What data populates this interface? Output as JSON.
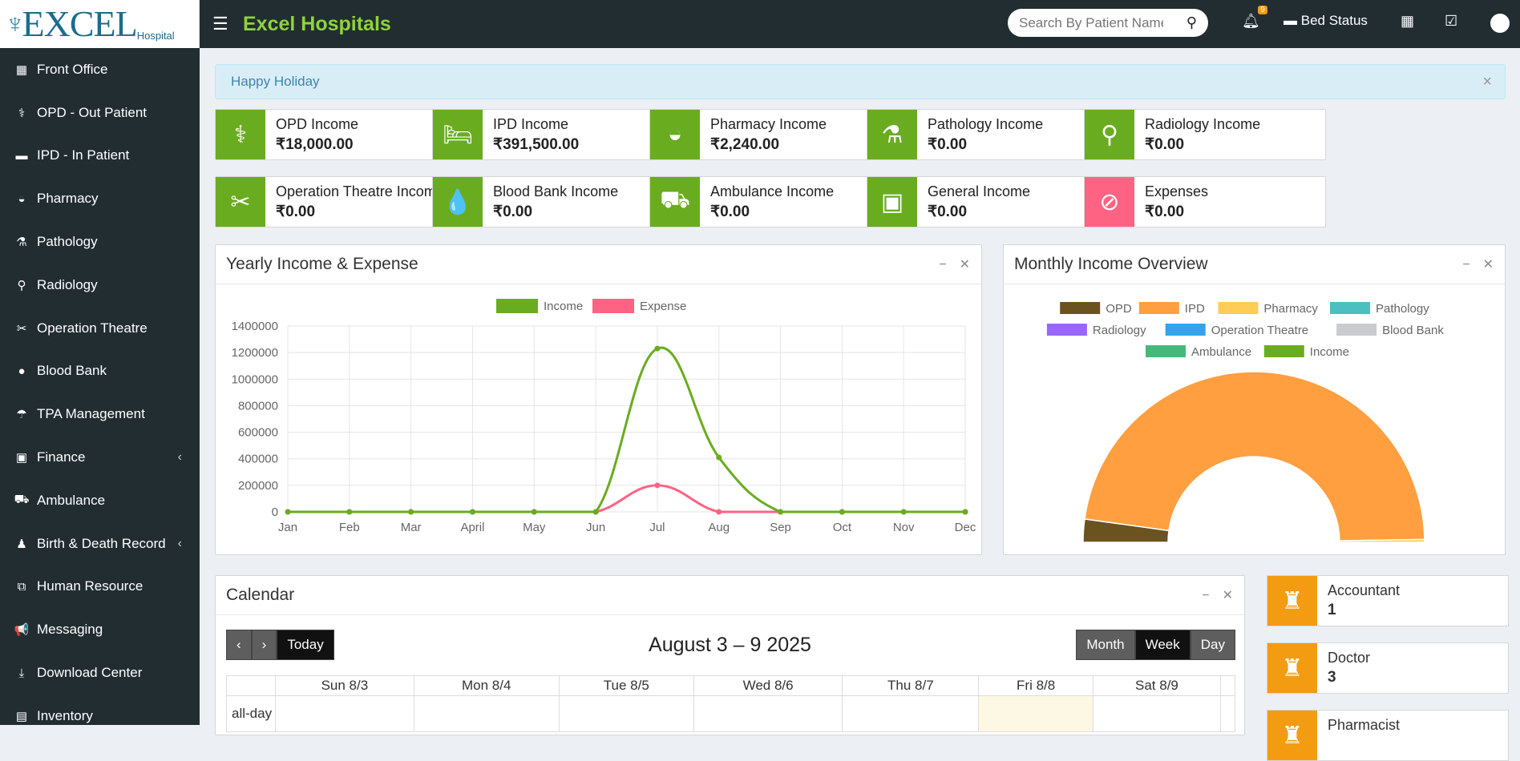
{
  "app": {
    "logo_text": "EXCEL",
    "logo_sub": "Hospital",
    "brand": "Excel Hospitals"
  },
  "sidebar": {
    "items": [
      {
        "label": "Front Office",
        "icon": "building-icon",
        "glyph": "▦"
      },
      {
        "label": "OPD - Out Patient",
        "icon": "stethoscope-icon",
        "glyph": "⚕"
      },
      {
        "label": "IPD - In Patient",
        "icon": "bed-icon",
        "glyph": "▬"
      },
      {
        "label": "Pharmacy",
        "icon": "mortar-icon",
        "glyph": "◒"
      },
      {
        "label": "Pathology",
        "icon": "flask-icon",
        "glyph": "⚗"
      },
      {
        "label": "Radiology",
        "icon": "microscope-icon",
        "glyph": "⚲"
      },
      {
        "label": "Operation Theatre",
        "icon": "scissors-icon",
        "glyph": "✂"
      },
      {
        "label": "Blood Bank",
        "icon": "drop-icon",
        "glyph": "●"
      },
      {
        "label": "TPA Management",
        "icon": "umbrella-icon",
        "glyph": "☂"
      },
      {
        "label": "Finance",
        "icon": "money-icon",
        "glyph": "▣",
        "caret": "‹"
      },
      {
        "label": "Ambulance",
        "icon": "ambulance-icon",
        "glyph": "⛟"
      },
      {
        "label": "Birth & Death Record",
        "icon": "family-icon",
        "glyph": "♟",
        "caret": "‹"
      },
      {
        "label": "Human Resource",
        "icon": "sitemap-icon",
        "glyph": "⧉"
      },
      {
        "label": "Messaging",
        "icon": "bullhorn-icon",
        "glyph": "📢"
      },
      {
        "label": "Download Center",
        "icon": "download-icon",
        "glyph": "⤓"
      },
      {
        "label": "Inventory",
        "icon": "boxes-icon",
        "glyph": "▤"
      }
    ]
  },
  "topbar": {
    "search_placeholder": "Search By Patient Name",
    "notif_count": "9",
    "bed_status": "Bed Status"
  },
  "alert": {
    "text": "Happy Holiday"
  },
  "income_boxes": [
    {
      "label": "OPD Income",
      "value": "₹18,000.00",
      "icon": "stethoscope-icon",
      "glyph": "⚕",
      "color": "#6aac1f"
    },
    {
      "label": "IPD Income",
      "value": "₹391,500.00",
      "icon": "bed-icon",
      "glyph": "🛏",
      "color": "#6aac1f"
    },
    {
      "label": "Pharmacy Income",
      "value": "₹2,240.00",
      "icon": "mortar-icon",
      "glyph": "◒",
      "color": "#6aac1f"
    },
    {
      "label": "Pathology Income",
      "value": "₹0.00",
      "icon": "flask-icon",
      "glyph": "⚗",
      "color": "#6aac1f"
    },
    {
      "label": "Radiology Income",
      "value": "₹0.00",
      "icon": "microscope-icon",
      "glyph": "⚲",
      "color": "#6aac1f"
    },
    {
      "label": "Operation Theatre Income",
      "value": "₹0.00",
      "icon": "scissors-icon",
      "glyph": "✂",
      "color": "#6aac1f"
    },
    {
      "label": "Blood Bank Income",
      "value": "₹0.00",
      "icon": "drop-icon",
      "glyph": "💧",
      "color": "#6aac1f"
    },
    {
      "label": "Ambulance Income",
      "value": "₹0.00",
      "icon": "ambulance-icon",
      "glyph": "⛟",
      "color": "#6aac1f"
    },
    {
      "label": "General Income",
      "value": "₹0.00",
      "icon": "money-icon",
      "glyph": "▣",
      "color": "#6aac1f"
    },
    {
      "label": "Expenses",
      "value": "₹0.00",
      "icon": "expense-icon",
      "glyph": "⊘",
      "color": "#ff6384"
    }
  ],
  "yearly_panel": {
    "title": "Yearly Income & Expense"
  },
  "monthly_panel": {
    "title": "Monthly Income Overview"
  },
  "chart_data": [
    {
      "type": "line",
      "x": [
        "Jan",
        "Feb",
        "Mar",
        "April",
        "May",
        "Jun",
        "Jul",
        "Aug",
        "Sep",
        "Oct",
        "Nov",
        "Dec"
      ],
      "series": [
        {
          "name": "Income",
          "color": "#6aac1f",
          "values": [
            0,
            0,
            0,
            0,
            0,
            0,
            1230000,
            410000,
            0,
            0,
            0,
            0
          ]
        },
        {
          "name": "Expense",
          "color": "#ff6384",
          "values": [
            0,
            0,
            0,
            0,
            0,
            0,
            200000,
            0,
            0,
            0,
            0,
            0
          ]
        }
      ],
      "yticks": [
        0,
        200000,
        400000,
        600000,
        800000,
        1000000,
        1200000,
        1400000
      ],
      "ylim": [
        0,
        1400000
      ],
      "grid": true,
      "legend": "top"
    },
    {
      "type": "pie",
      "categories": [
        "OPD",
        "IPD",
        "Pharmacy",
        "Pathology",
        "Radiology",
        "Operation Theatre",
        "Blood Bank",
        "Ambulance",
        "Income"
      ],
      "colors": [
        "#6b5320",
        "#ff9f40",
        "#ffcd56",
        "#4bc0c0",
        "#9966ff",
        "#36a2eb",
        "#c9cbcf",
        "#45b97c",
        "#6aac1f"
      ],
      "values": [
        18000,
        391500,
        2240,
        0,
        0,
        0,
        0,
        0,
        0
      ],
      "legend": "top"
    }
  ],
  "calendar": {
    "title": "Calendar",
    "range": "August 3 – 9 2025",
    "today": "Today",
    "views": [
      "Month",
      "Week",
      "Day"
    ],
    "active_view": "Week",
    "days": [
      "Sun 8/3",
      "Mon 8/4",
      "Tue 8/5",
      "Wed 8/6",
      "Thu 8/7",
      "Fri 8/8",
      "Sat 8/9"
    ],
    "today_index": 5,
    "allday_label": "all-day"
  },
  "staff_boxes": [
    {
      "label": "Accountant",
      "value": "1",
      "icon": "user-secret-icon"
    },
    {
      "label": "Doctor",
      "value": "3",
      "icon": "user-secret-icon"
    },
    {
      "label": "Pharmacist",
      "value": "",
      "icon": "user-secret-icon"
    }
  ]
}
